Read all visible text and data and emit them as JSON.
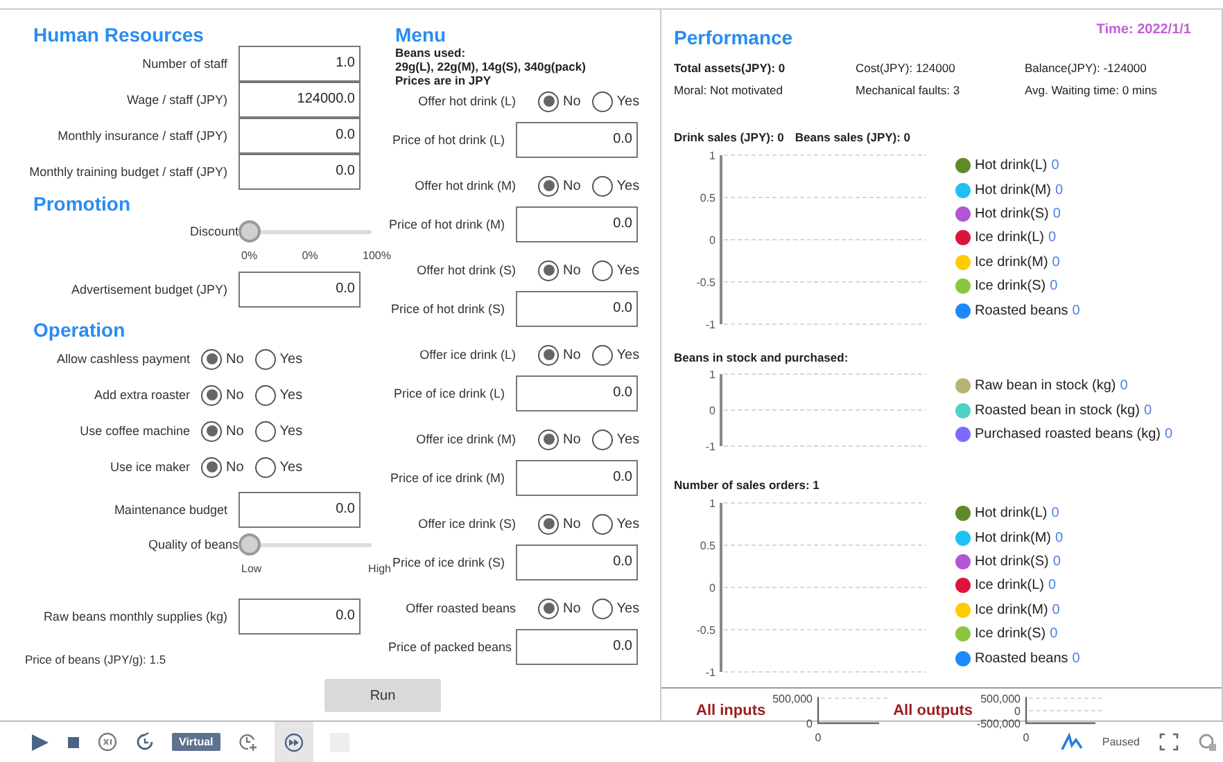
{
  "left_sections": [
    {
      "title": "Human Resources",
      "rows": [
        {
          "kind": "field",
          "label": "Number of staff",
          "value": "1.0"
        },
        {
          "kind": "field",
          "label": "Wage / staff (JPY)",
          "value": "124000.0"
        },
        {
          "kind": "field",
          "label": "Monthly insurance / staff (JPY)",
          "value": "0.0"
        },
        {
          "kind": "field",
          "label": "Monthly training budget / staff (JPY)",
          "value": "0.0"
        }
      ]
    },
    {
      "title": "Promotion",
      "rows": [
        {
          "kind": "slider",
          "label": "Discount",
          "level": 0,
          "ticks": [
            "0%",
            "0%",
            "100%"
          ]
        },
        {
          "kind": "field",
          "label": "Advertisement budget (JPY)",
          "value": "0.0"
        }
      ]
    },
    {
      "title": "Operation",
      "rows": [
        {
          "kind": "radio",
          "label": "Allow cashless payment",
          "options": [
            {
              "label": "No",
              "selected": true
            },
            {
              "label": "Yes",
              "selected": false
            }
          ]
        },
        {
          "kind": "radio",
          "label": "Add extra roaster",
          "options": [
            {
              "label": "No",
              "selected": true
            },
            {
              "label": "Yes",
              "selected": false
            }
          ]
        },
        {
          "kind": "radio",
          "label": "Use coffee machine",
          "options": [
            {
              "label": "No",
              "selected": true
            },
            {
              "label": "Yes",
              "selected": false
            }
          ]
        },
        {
          "kind": "radio",
          "label": "Use ice maker",
          "options": [
            {
              "label": "No",
              "selected": true
            },
            {
              "label": "Yes",
              "selected": false
            }
          ]
        },
        {
          "kind": "field",
          "label": "Maintenance budget",
          "value": "0.0"
        },
        {
          "kind": "slider",
          "label": "Quality of beans",
          "level": 0,
          "ticks": [
            "Low",
            "High"
          ]
        },
        {
          "kind": "field",
          "label": "Raw beans monthly supplies (kg)",
          "value": "0.0"
        },
        {
          "kind": "note",
          "text": "Price of beans (JPY/g): 1.5"
        }
      ]
    }
  ],
  "menu": {
    "title": "Menu",
    "notes": [
      "Beans used:",
      "29g(L), 22g(M), 14g(S), 340g(pack)",
      "Prices are in JPY"
    ],
    "rows": [
      {
        "kind": "radio",
        "label": "Offer hot drink (L)",
        "options": [
          {
            "label": "No",
            "selected": true
          },
          {
            "label": "Yes",
            "selected": false
          }
        ]
      },
      {
        "kind": "field",
        "label": "Price of hot drink (L)",
        "value": "0.0"
      },
      {
        "kind": "radio",
        "label": "Offer hot drink (M)",
        "options": [
          {
            "label": "No",
            "selected": true
          },
          {
            "label": "Yes",
            "selected": false
          }
        ]
      },
      {
        "kind": "field",
        "label": "Price of hot drink (M)",
        "value": "0.0"
      },
      {
        "kind": "radio",
        "label": "Offer hot drink (S)",
        "options": [
          {
            "label": "No",
            "selected": true
          },
          {
            "label": "Yes",
            "selected": false
          }
        ]
      },
      {
        "kind": "field",
        "label": "Price of hot drink (S)",
        "value": "0.0"
      },
      {
        "kind": "radio",
        "label": "Offer ice drink (L)",
        "options": [
          {
            "label": "No",
            "selected": true
          },
          {
            "label": "Yes",
            "selected": false
          }
        ]
      },
      {
        "kind": "field",
        "label": "Price of ice drink (L)",
        "value": "0.0"
      },
      {
        "kind": "radio",
        "label": "Offer ice drink (M)",
        "options": [
          {
            "label": "No",
            "selected": true
          },
          {
            "label": "Yes",
            "selected": false
          }
        ]
      },
      {
        "kind": "field",
        "label": "Price of ice drink (M)",
        "value": "0.0"
      },
      {
        "kind": "radio",
        "label": "Offer ice drink (S)",
        "options": [
          {
            "label": "No",
            "selected": true
          },
          {
            "label": "Yes",
            "selected": false
          }
        ]
      },
      {
        "kind": "field",
        "label": "Price of ice drink (S)",
        "value": "0.0"
      },
      {
        "kind": "radio",
        "label": "Offer roasted beans",
        "options": [
          {
            "label": "No",
            "selected": true
          },
          {
            "label": "Yes",
            "selected": false
          }
        ]
      },
      {
        "kind": "field",
        "label": "Price of packed beans",
        "value": "0.0"
      }
    ]
  },
  "run_button": "Run",
  "performance": {
    "title": "Performance",
    "time": "Time: 2022/1/1",
    "stats": [
      {
        "text": "Total assets(JPY): 0",
        "bold": true
      },
      {
        "text": "Cost(JPY): 124000",
        "bold": false
      },
      {
        "text": "Balance(JPY): -124000",
        "bold": false
      },
      {
        "text": "Moral: Not motivated",
        "bold": false
      },
      {
        "text": "Mechanical faults: 3",
        "bold": false
      },
      {
        "text": "Avg. Waiting time: 0 mins",
        "bold": false
      }
    ],
    "charts": [
      {
        "headers": [
          "Drink sales (JPY): 0",
          "Beans sales (JPY): 0"
        ],
        "axis_labels": [
          "1",
          "0.5",
          "0",
          "-0.5",
          "-1"
        ],
        "legend": [
          {
            "label": "Hot drink(L)",
            "value": "0",
            "color": "#5e8a2a"
          },
          {
            "label": "Hot drink(M)",
            "value": "0",
            "color": "#1ec0f5"
          },
          {
            "label": "Hot drink(S)",
            "value": "0",
            "color": "#b455d6"
          },
          {
            "label": "Ice drink(L)",
            "value": "0",
            "color": "#dc143c"
          },
          {
            "label": "Ice drink(M)",
            "value": "0",
            "color": "#ffcc00"
          },
          {
            "label": "Ice drink(S)",
            "value": "0",
            "color": "#8cc63f"
          },
          {
            "label": "Roasted beans",
            "value": "0",
            "color": "#1e88ff"
          }
        ]
      },
      {
        "headers": [
          "Beans in stock and purchased:"
        ],
        "axis_labels": [
          "1",
          "0",
          "-1"
        ],
        "legend": [
          {
            "label": "Raw bean in stock (kg)",
            "value": "0",
            "color": "#b8b476"
          },
          {
            "label": "Roasted bean in stock (kg)",
            "value": "0",
            "color": "#4fd1c5"
          },
          {
            "label": "Purchased roasted beans (kg)",
            "value": "0",
            "color": "#7b6cff"
          }
        ]
      },
      {
        "headers": [
          "Number of sales orders: 1"
        ],
        "axis_labels": [
          "1",
          "0.5",
          "0",
          "-0.5",
          "-1"
        ],
        "legend": [
          {
            "label": "Hot drink(L)",
            "value": "0",
            "color": "#5e8a2a"
          },
          {
            "label": "Hot drink(M)",
            "value": "0",
            "color": "#1ec0f5"
          },
          {
            "label": "Hot drink(S)",
            "value": "0",
            "color": "#b455d6"
          },
          {
            "label": "Ice drink(L)",
            "value": "0",
            "color": "#dc143c"
          },
          {
            "label": "Ice drink(M)",
            "value": "0",
            "color": "#ffcc00"
          },
          {
            "label": "Ice drink(S)",
            "value": "0",
            "color": "#8cc63f"
          },
          {
            "label": "Roasted beans",
            "value": "0",
            "color": "#1e88ff"
          }
        ]
      }
    ]
  },
  "io_charts": [
    {
      "label": "All inputs",
      "axis_labels": [
        "500,000",
        "0"
      ],
      "x_tick_label": "0"
    },
    {
      "label": "All outputs",
      "axis_labels": [
        "500,000",
        "0",
        "-500,000"
      ],
      "x_tick_label": "0"
    }
  ],
  "toolbar": {
    "badge": "Virtual",
    "status": "Paused"
  }
}
